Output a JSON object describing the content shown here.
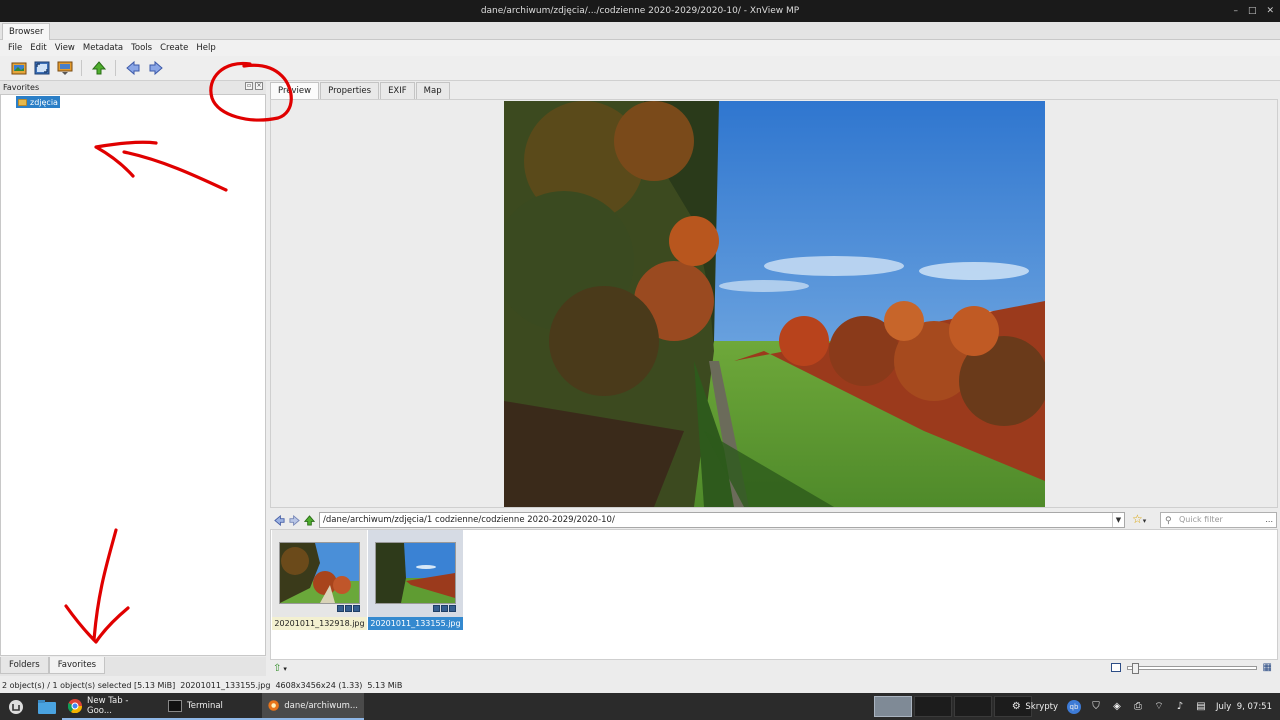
{
  "window": {
    "title": "dane/archiwum/zdjęcia/.../codzienne 2020-2029/2020-10/ - XnView MP",
    "controls": [
      "–",
      "□",
      "✕"
    ]
  },
  "main_tab": "Browser",
  "menu": [
    "File",
    "Edit",
    "View",
    "Metadata",
    "Tools",
    "Create",
    "Help"
  ],
  "toolbar": {
    "icons": [
      "open-browser-icon",
      "fullscreen-icon",
      "slideshow-icon",
      "go-up-icon",
      "back-icon",
      "forward-icon"
    ]
  },
  "left_panel": {
    "title": "Favorites",
    "tree": [
      {
        "label": "zdjęcia",
        "selected": true
      }
    ],
    "bottom_tabs": [
      "Folders",
      "Favorites"
    ],
    "active_bottom_tab": "Favorites"
  },
  "right_tabs": [
    "Preview",
    "Properties",
    "EXIF",
    "Map"
  ],
  "active_right_tab": "Preview",
  "address": {
    "path": "/dane/archiwum/zdjęcia/1 codzienne/codzienne 2020-2029/2020-10/",
    "quick_filter_placeholder": "Quick filter",
    "more": "..."
  },
  "thumbnails": [
    {
      "filename": "20201011_132918.jpg",
      "selected": false
    },
    {
      "filename": "20201011_133155.jpg",
      "selected": true
    }
  ],
  "zoom_slider": {
    "value_fraction": 0.03
  },
  "status": {
    "objects": "2 object(s) / 1 object(s) selected [5.13 MiB]",
    "file": "20201011_133155.jpg",
    "dimensions": "4608x3456x24 (1.33)",
    "size": "5.13 MiB"
  },
  "taskbar": {
    "apps": [
      {
        "label": "New Tab - Goo...",
        "icon": "chrome-icon"
      },
      {
        "label": "Terminal",
        "icon": "terminal-icon"
      },
      {
        "label": "dane/archiwum...",
        "icon": "xnview-icon",
        "active": true
      }
    ],
    "workspaces": 4,
    "current_workspace": 1,
    "tray_label": "Skrypty",
    "clock": "July  9, 07:51"
  },
  "colors": {
    "selection": "#2b7fc7",
    "annotation": "#e00000",
    "sky": "#3b86d6"
  }
}
